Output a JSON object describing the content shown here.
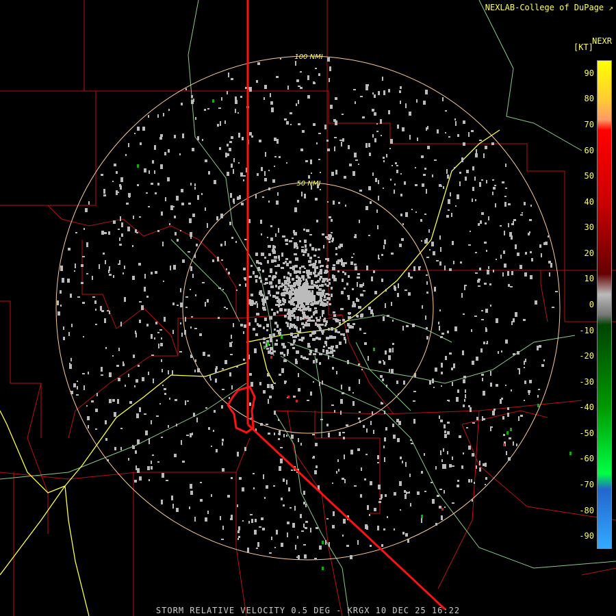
{
  "credit": "NEXLAB-College of DuPage",
  "product_code": "NEXR",
  "units_label": "[KT]",
  "footer": "STORM RELATIVE VELOCITY 0.5 DEG - KRGX 10 DEC 25 16:22",
  "range_rings": [
    {
      "label": "50 NMI",
      "nmi": 50
    },
    {
      "label": "100 NMI",
      "nmi": 100
    }
  ],
  "legend": {
    "ticks": [
      "90",
      "80",
      "70",
      "60",
      "50",
      "40",
      "30",
      "20",
      "10",
      "0",
      "-10",
      "-20",
      "-30",
      "-40",
      "-50",
      "-60",
      "-70",
      "-80",
      "-90"
    ],
    "color_stops": [
      {
        "value": 95,
        "color": "#ffff00"
      },
      {
        "value": 80,
        "color": "#ffcc33"
      },
      {
        "value": 72,
        "color": "#ff9966"
      },
      {
        "value": 68,
        "color": "#ff0000"
      },
      {
        "value": 40,
        "color": "#cc0000"
      },
      {
        "value": 12,
        "color": "#660000"
      },
      {
        "value": 4,
        "color": "#bbbbbb"
      },
      {
        "value": -4,
        "color": "#777777"
      },
      {
        "value": -8,
        "color": "#004400"
      },
      {
        "value": -40,
        "color": "#009900"
      },
      {
        "value": -66,
        "color": "#00ff44"
      },
      {
        "value": -72,
        "color": "#2266cc"
      },
      {
        "value": -95,
        "color": "#33aaff"
      }
    ]
  },
  "colors": {
    "background": "#000000",
    "boundaries": "#bb1111",
    "highways": "#ffff44",
    "roads": "#88cc88",
    "range_ring": "#ffcc99",
    "ground_clutter": "#bbbbbb",
    "inbound_velocity": "#11aa11",
    "outbound_velocity": "#cc2222",
    "warning_polygon": "#ff1111"
  }
}
